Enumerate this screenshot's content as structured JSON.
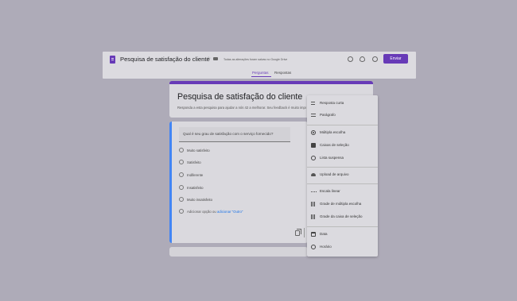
{
  "header": {
    "title": "Pesquisa de satisfação do cliente",
    "saved_status": "Todas as alterações foram salvas no Google Drive",
    "send_label": "Enviar",
    "tabs": [
      {
        "label": "Perguntas",
        "active": true
      },
      {
        "label": "Respostas",
        "active": false
      }
    ],
    "icons": [
      "form-icon",
      "star-icon",
      "folder-icon",
      "palette-icon",
      "preview-icon",
      "settings-icon"
    ],
    "accent_color": "#673ab7"
  },
  "form": {
    "title": "Pesquisa de satisfação do cliente",
    "description": "Responda a esta pesquisa para ajudar a nós 42 a melhorar. Seu feedback é muito importante!"
  },
  "question": {
    "text": "Qual é seu grau de satisfação com o serviço fornecido?",
    "options": [
      "Muito satisfeito",
      "Satisfeito",
      "Indiferente",
      "Insatisfeito",
      "Muito insatisfeito"
    ],
    "add_option": "Adicionar opção",
    "add_or": "ou",
    "add_other": "adicionar \"Outro\""
  },
  "menu": {
    "items": [
      {
        "label": "Resposta curta",
        "icon": "short-answer-icon"
      },
      {
        "label": "Parágrafo",
        "icon": "paragraph-icon"
      },
      {
        "label": "Múltipla escolha",
        "icon": "radio-icon"
      },
      {
        "label": "Caixas de seleção",
        "icon": "checkbox-icon"
      },
      {
        "label": "Lista suspensa",
        "icon": "dropdown-icon"
      },
      {
        "label": "Upload de arquivo",
        "icon": "upload-icon"
      },
      {
        "label": "Escala linear",
        "icon": "linear-scale-icon"
      },
      {
        "label": "Grade de múltipla escolha",
        "icon": "grid-icon"
      },
      {
        "label": "Grade da caixa de seleção",
        "icon": "grid-icon"
      },
      {
        "label": "Data",
        "icon": "calendar-icon"
      },
      {
        "label": "Horário",
        "icon": "clock-icon"
      }
    ]
  }
}
